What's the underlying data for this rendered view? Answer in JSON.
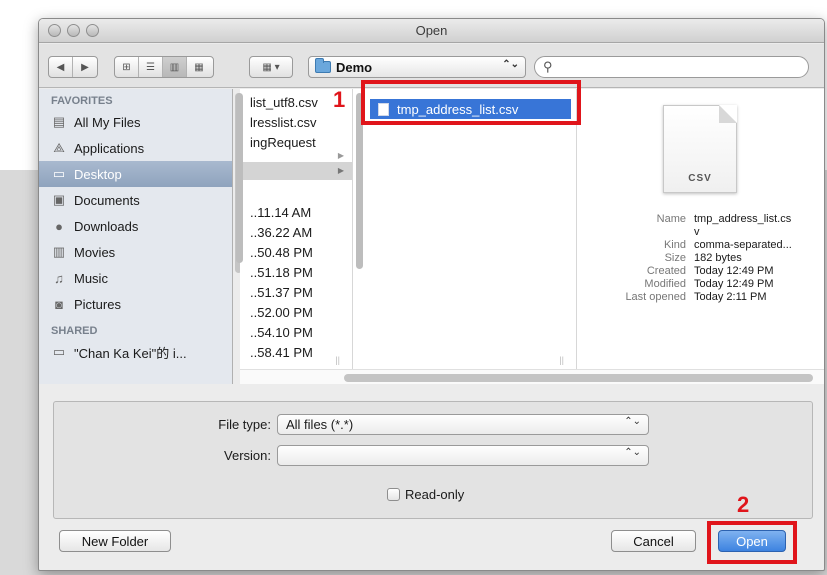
{
  "window": {
    "title": "Open"
  },
  "toolbar": {
    "location": "Demo",
    "search_placeholder": "",
    "nav_back_icon": "chevron-left-icon",
    "nav_forward_icon": "chevron-right-icon"
  },
  "sidebar": {
    "favorites_header": "FAVORITES",
    "favorites": [
      {
        "label": "All My Files",
        "icon": "all-files-icon"
      },
      {
        "label": "Applications",
        "icon": "applications-icon"
      },
      {
        "label": "Desktop",
        "icon": "desktop-icon",
        "selected": true
      },
      {
        "label": "Documents",
        "icon": "documents-icon"
      },
      {
        "label": "Downloads",
        "icon": "downloads-icon"
      },
      {
        "label": "Movies",
        "icon": "movies-icon"
      },
      {
        "label": "Music",
        "icon": "music-icon"
      },
      {
        "label": "Pictures",
        "icon": "pictures-icon"
      }
    ],
    "shared_header": "SHARED",
    "shared": [
      {
        "label": "\"Chan Ka Kei\"的 i...",
        "icon": "computer-icon"
      }
    ]
  },
  "column1": {
    "top_rows": [
      "list_utf8.csv",
      "lresslist.csv",
      "ingRequest"
    ],
    "time_rows": [
      "..11.14 AM",
      "..36.22 AM",
      "..50.48 PM",
      "..51.18 PM",
      "..51.37 PM",
      "..52.00 PM",
      "..54.10 PM",
      "..58.41 PM"
    ]
  },
  "column2": {
    "selected_file": "tmp_address_list.csv"
  },
  "preview": {
    "icon_label": "CSV",
    "rows": [
      {
        "key": "Name",
        "value": "tmp_address_list.cs"
      },
      {
        "key": "",
        "value": "v"
      },
      {
        "key": "Kind",
        "value": "comma-separated..."
      },
      {
        "key": "Size",
        "value": "182 bytes"
      },
      {
        "key": "Created",
        "value": "Today 12:49 PM"
      },
      {
        "key": "Modified",
        "value": "Today 12:49 PM"
      },
      {
        "key": "Last opened",
        "value": "Today 2:11 PM"
      }
    ]
  },
  "options": {
    "file_type_label": "File type:",
    "file_type_value": "All files (*.*)",
    "version_label": "Version:",
    "version_value": "",
    "readonly_label": "Read-only"
  },
  "buttons": {
    "new_folder": "New Folder",
    "cancel": "Cancel",
    "open": "Open"
  },
  "annotations": {
    "step1": "1",
    "step2": "2",
    "color": "#e0151b"
  }
}
